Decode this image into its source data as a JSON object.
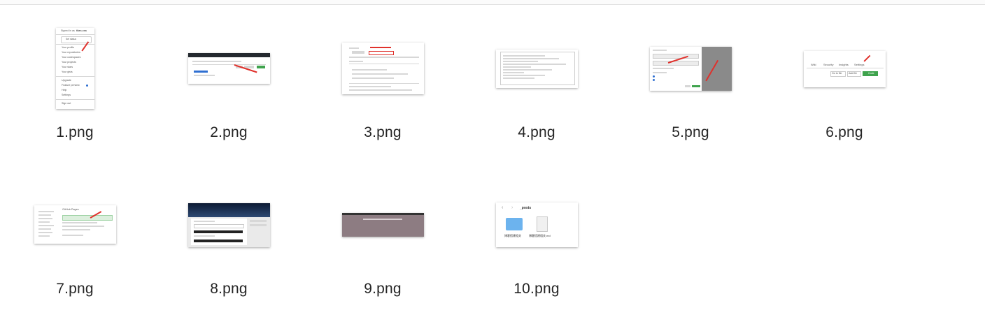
{
  "files": [
    {
      "name": "1.png"
    },
    {
      "name": "2.png"
    },
    {
      "name": "3.png"
    },
    {
      "name": "4.png"
    },
    {
      "name": "5.png"
    },
    {
      "name": "6.png"
    },
    {
      "name": "7.png"
    },
    {
      "name": "8.png"
    },
    {
      "name": "9.png"
    },
    {
      "name": "10.png"
    }
  ],
  "thumb_text": {
    "t1": {
      "signed_in": "Signed in as",
      "username": "titan-xsa",
      "set_status": "Set status",
      "menu": [
        "Your profile",
        "Your repositories",
        "Your codespaces",
        "Your projects",
        "Your stars",
        "Your gists",
        "Upgrade",
        "Feature preview",
        "Help",
        "Settings",
        "Sign out"
      ]
    },
    "t6": {
      "tabs": [
        "Wiki",
        "Security",
        "Insights",
        "Settings"
      ],
      "go_to_file": "Go to file",
      "add_file": "Add file",
      "code": "Code"
    },
    "t7": {
      "title": "GitHub Pages"
    },
    "t10": {
      "folder_path": "_posts",
      "file1": "博客搭建相关",
      "file2": "博客搭建相关.md"
    }
  }
}
